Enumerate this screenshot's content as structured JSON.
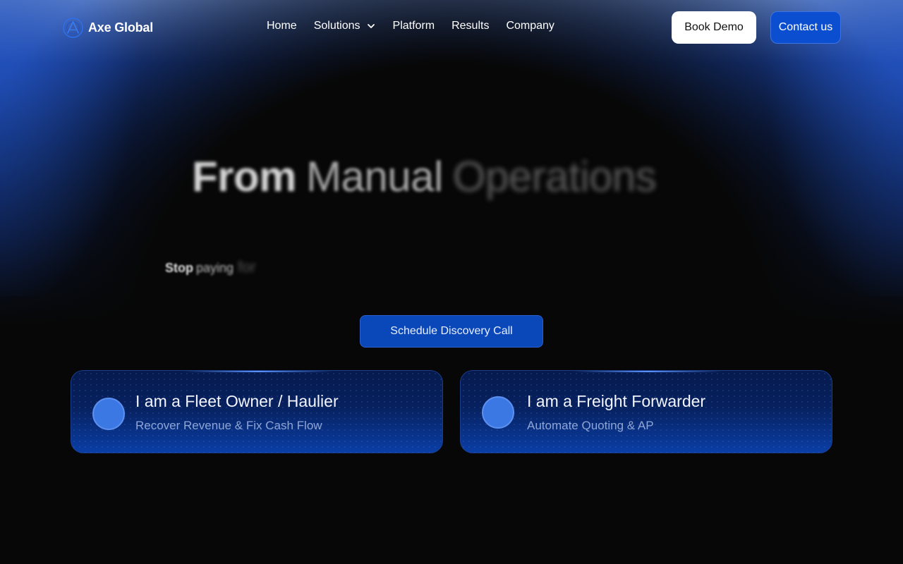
{
  "brand": {
    "name": "Axe Global",
    "logo_icon": "globe-ring-icon",
    "accent": "#0b4fd0"
  },
  "nav": {
    "items": [
      {
        "label": "Home"
      },
      {
        "label": "Solutions",
        "icon": "chevron-down-icon"
      },
      {
        "label": "Platform"
      },
      {
        "label": "Results"
      },
      {
        "label": "Company"
      }
    ],
    "book_demo_label": "Book Demo",
    "contact_label": "Contact us"
  },
  "hero": {
    "headline": {
      "word1": "From",
      "word2": "Manual",
      "word3": "Operations"
    },
    "subtitle": {
      "word1": "Stop",
      "word2": "paying",
      "word3": "for"
    },
    "cta_label": "Schedule Discovery Call"
  },
  "cards": [
    {
      "title": "I am a Fleet Owner / Haulier",
      "subtitle": "Recover Revenue & Fix Cash Flow"
    },
    {
      "title": "I am a Freight Forwarder",
      "subtitle": "Automate Quoting & AP"
    }
  ]
}
